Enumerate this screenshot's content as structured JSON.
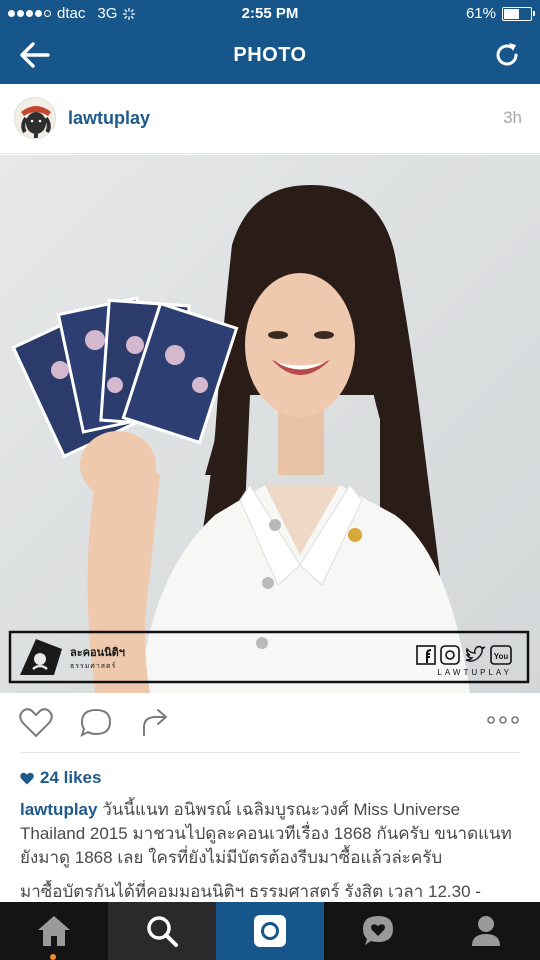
{
  "status_bar": {
    "carrier": "dtac",
    "network": "3G",
    "time": "2:55 PM",
    "battery": "61%",
    "battery_level": 0.61,
    "signal_bars": 4
  },
  "nav": {
    "title": "PHOTO",
    "back_icon": "arrow-left-icon",
    "refresh_icon": "refresh-icon"
  },
  "post": {
    "username": "lawtuplay",
    "time_ago": "3h",
    "overlay_logo_text_th": "ละคอนนิติฯ",
    "overlay_logo_sub": "ธรรมศาสตร์",
    "overlay_brand": "LAWTUPLAY",
    "likes": "24 likes",
    "caption_user": "lawtuplay",
    "caption_text": "วันนี้แนท อนิพรณ์  เฉลิมบูรณะวงศ์ Miss Universe Thailand 2015 มาชวนไปดูละคอนเวทีเรื่อง 1868 กันครับ ขนาดแนทยังมาดู 1868 เลย ใครที่ยังไม่มีบัตรต้องรีบมาซื้อแล้วล่ะครับ",
    "caption_text_2": "มาซื้อบัตรกันได้ที่คอมมอนนิติฯ ธรรมศาสตร์ รังสิต เวลา 12.30 -"
  },
  "colors": {
    "brand_blue": "#16568a",
    "link_blue": "#1f5a8a",
    "tab_bar": "#141414"
  },
  "tabs": [
    {
      "name": "home-icon"
    },
    {
      "name": "search-icon"
    },
    {
      "name": "camera-icon"
    },
    {
      "name": "activity-icon"
    },
    {
      "name": "profile-icon"
    }
  ]
}
